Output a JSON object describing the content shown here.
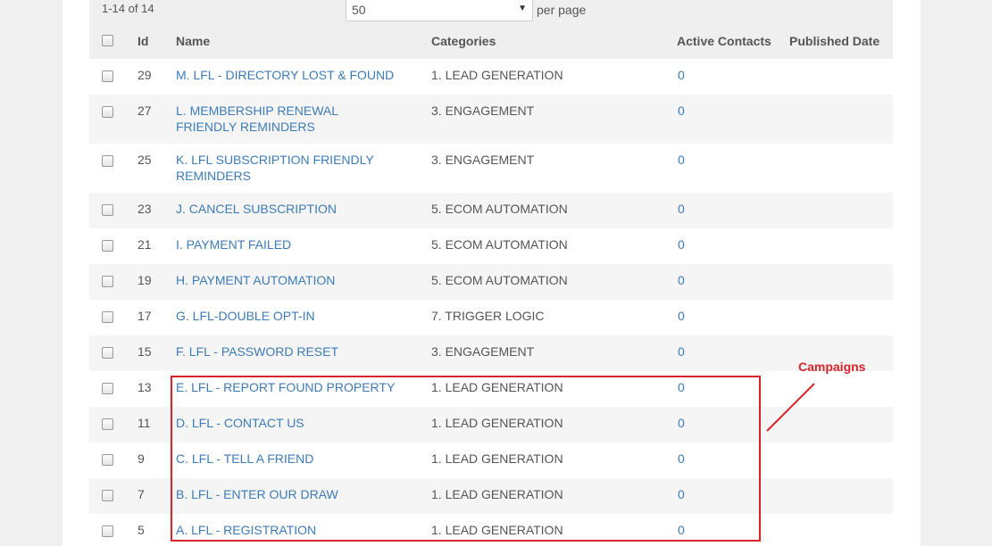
{
  "pagination": {
    "count_text": "1-14 of 14",
    "per_page_value": "50",
    "per_page_label": "per page"
  },
  "table": {
    "columns": {
      "id": "Id",
      "name": "Name",
      "categories": "Categories",
      "active_contacts": "Active Contacts",
      "published_date": "Published Date"
    },
    "rows": [
      {
        "id": "29",
        "name": "M. LFL - DIRECTORY LOST & FOUND",
        "category": "1. LEAD GENERATION",
        "contacts": "0"
      },
      {
        "id": "27",
        "name": "L. MEMBERSHIP RENEWAL FRIENDLY REMINDERS",
        "category": "3. ENGAGEMENT",
        "contacts": "0"
      },
      {
        "id": "25",
        "name": "K. LFL SUBSCRIPTION FRIENDLY REMINDERS",
        "category": "3. ENGAGEMENT",
        "contacts": "0"
      },
      {
        "id": "23",
        "name": "J. CANCEL SUBSCRIPTION",
        "category": "5. ECOM AUTOMATION",
        "contacts": "0"
      },
      {
        "id": "21",
        "name": "I. PAYMENT FAILED",
        "category": "5. ECOM AUTOMATION",
        "contacts": "0"
      },
      {
        "id": "19",
        "name": "H. PAYMENT AUTOMATION",
        "category": "5. ECOM AUTOMATION",
        "contacts": "0"
      },
      {
        "id": "17",
        "name": "G. LFL-DOUBLE OPT-IN",
        "category": "7. TRIGGER LOGIC",
        "contacts": "0"
      },
      {
        "id": "15",
        "name": "F. LFL - PASSWORD RESET",
        "category": "3. ENGAGEMENT",
        "contacts": "0"
      },
      {
        "id": "13",
        "name": "E. LFL - REPORT FOUND PROPERTY",
        "category": "1. LEAD GENERATION",
        "contacts": "0"
      },
      {
        "id": "11",
        "name": "D. LFL - CONTACT US",
        "category": "1. LEAD GENERATION",
        "contacts": "0"
      },
      {
        "id": "9",
        "name": "C. LFL - TELL A FRIEND",
        "category": "1. LEAD GENERATION",
        "contacts": "0"
      },
      {
        "id": "7",
        "name": "B. LFL - ENTER OUR DRAW",
        "category": "1. LEAD GENERATION",
        "contacts": "0"
      },
      {
        "id": "5",
        "name": "A. LFL - REGISTRATION",
        "category": "1. LEAD GENERATION",
        "contacts": "0"
      }
    ]
  },
  "annotation": {
    "label": "Campaigns",
    "color": "#d8232a"
  },
  "colors": {
    "link": "#3d7cb8",
    "header_bg": "#efefef",
    "alt_row_bg": "#f5f5f5"
  }
}
